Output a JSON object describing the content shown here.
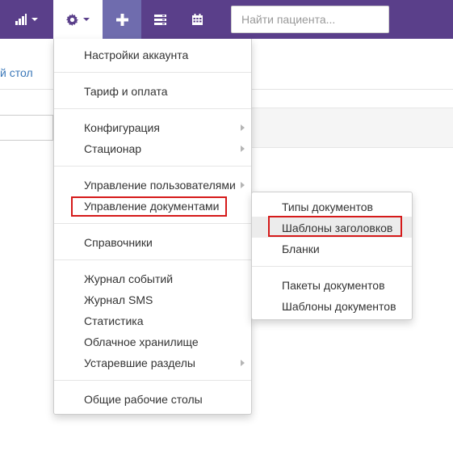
{
  "search": {
    "placeholder": "Найти пациента..."
  },
  "page": {
    "desk_link": "й стол"
  },
  "main_menu": {
    "account_settings": "Настройки аккаунта",
    "tariff": "Тариф и оплата",
    "configuration": "Конфигурация",
    "hospital": "Стационар",
    "users": "Управление пользователями",
    "documents": "Управление документами",
    "directories": "Справочники",
    "event_log": "Журнал событий",
    "sms_log": "Журнал SMS",
    "statistics": "Статистика",
    "cloud": "Облачное хранилище",
    "legacy": "Устаревшие разделы",
    "shared_desks": "Общие рабочие столы"
  },
  "sub_menu": {
    "doc_types": "Типы документов",
    "header_templates": "Шаблоны заголовков",
    "blanks": "Бланки",
    "doc_packages": "Пакеты документов",
    "doc_templates": "Шаблоны документов"
  },
  "icons": {
    "stats": "bar-chart-icon",
    "gear": "gear-icon",
    "plus": "plus-icon",
    "list": "list-icon",
    "calendar": "calendar-icon"
  },
  "colors": {
    "topbar": "#5a3f8a",
    "plus_bg": "#6f6cae",
    "link": "#3a77b8",
    "annotation": "#d51a1a"
  }
}
